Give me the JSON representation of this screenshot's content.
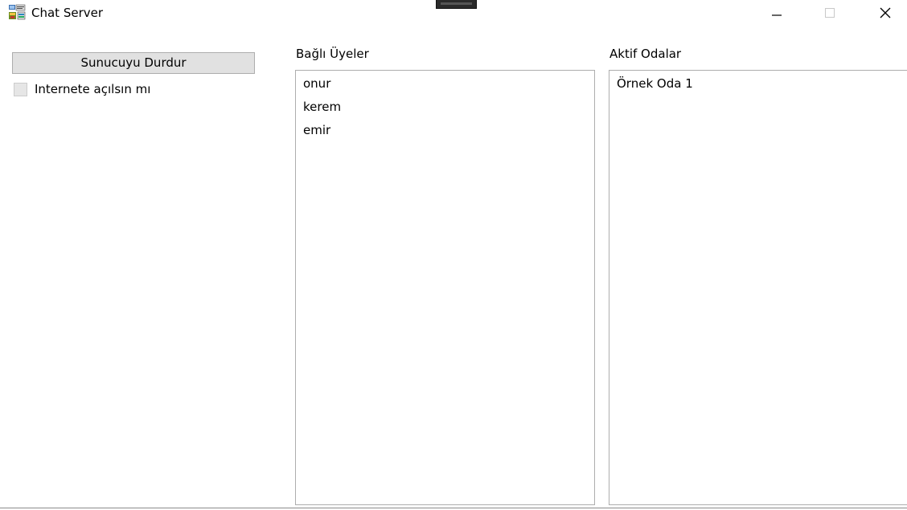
{
  "window": {
    "title": "Chat Server",
    "icon": "chat-server-app-icon",
    "controls": {
      "minimize": "minimize-icon",
      "maximize": "maximize-icon",
      "close": "close-icon"
    }
  },
  "controls": {
    "stop_server_label": "Sunucuyu Durdur",
    "internet_checkbox_label": "Internete açılsın mı",
    "internet_checkbox_checked": false
  },
  "members": {
    "label": "Bağlı Üyeler",
    "items": [
      "onur",
      "kerem",
      "emir"
    ]
  },
  "rooms": {
    "label": "Aktif Odalar",
    "items": [
      "Örnek Oda 1"
    ]
  },
  "colors": {
    "button_face": "#e1e1e1",
    "button_border": "#adadad",
    "list_border": "#adadad",
    "checkbox_face": "#e6e6e6"
  }
}
